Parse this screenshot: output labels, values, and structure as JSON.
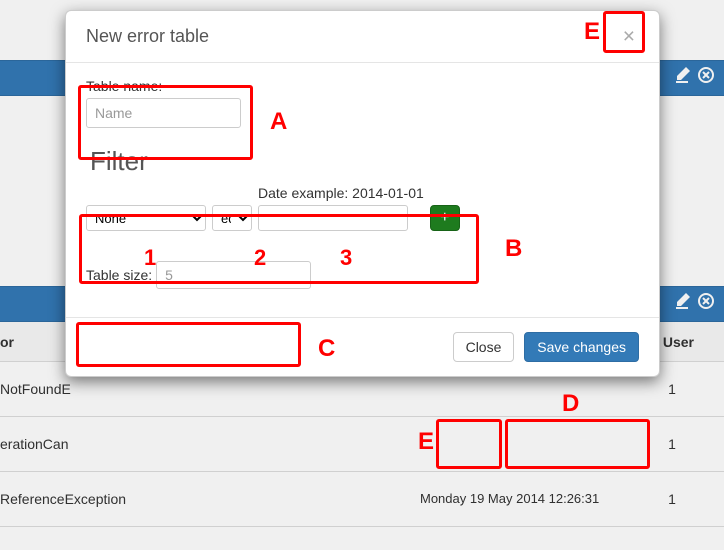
{
  "modal": {
    "title": "New error table",
    "close_x": "×",
    "table_name_label": "Table name:",
    "table_name_placeholder": "Name",
    "filter_heading": "Filter",
    "date_hint": "Date example: 2014-01-01",
    "field_select_value": "None",
    "operator_select_value": "eq",
    "filter_value": "",
    "add_button_label": "+",
    "table_size_label": "Table size:",
    "table_size_placeholder": "5",
    "close_button": "Close",
    "save_button": "Save changes"
  },
  "background": {
    "header_col_or": "or",
    "header_col_user": "User",
    "rows": [
      {
        "exception": "NotFoundE",
        "date": "",
        "user": "1"
      },
      {
        "exception": "erationCan",
        "date": "",
        "user": "1"
      },
      {
        "exception": "ReferenceException",
        "date": "Monday 19 May 2014 12:26:31",
        "user": "1"
      }
    ]
  },
  "annotations": {
    "A": "A",
    "B": "B",
    "C": "C",
    "D": "D",
    "E": "E",
    "one": "1",
    "two": "2",
    "three": "3"
  }
}
